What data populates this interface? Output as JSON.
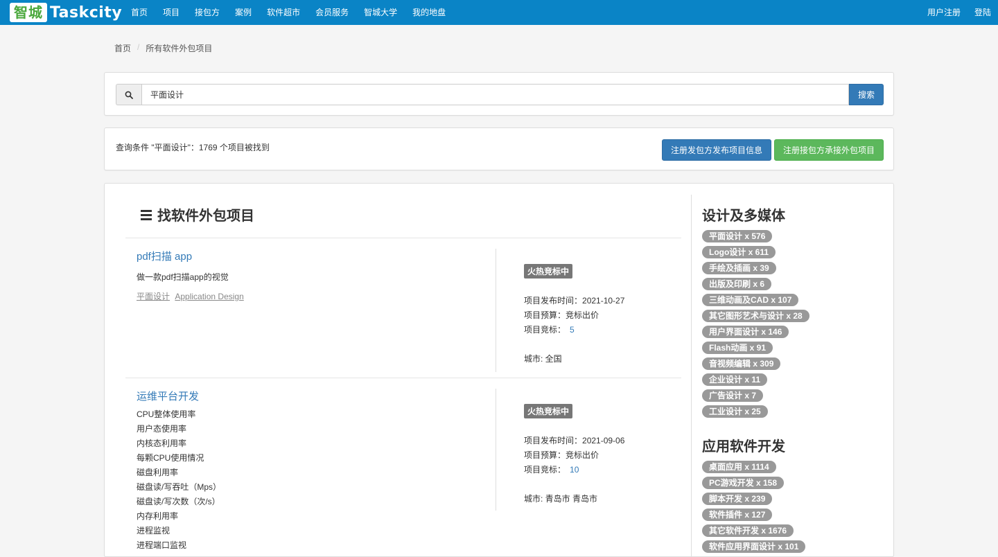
{
  "nav": {
    "logo_badge": "智城",
    "logo_text": "Taskcity",
    "menu": [
      "首页",
      "项目",
      "接包方",
      "案例",
      "软件超市",
      "会员服务",
      "智城大学",
      "我的地盘"
    ],
    "register": "用户注册",
    "login": "登陆"
  },
  "breadcrumb": {
    "home": "首页",
    "sep": "/",
    "current": "所有软件外包项目"
  },
  "search": {
    "icon": "search-icon",
    "value": "平面设计",
    "button": "搜索"
  },
  "result": {
    "text": "查询条件 \"平面设计\"：1769 个项目被找到",
    "btn_publish": "注册发包方发布项目信息",
    "btn_accept": "注册接包方承接外包项目"
  },
  "main": {
    "title": "找软件外包项目",
    "projects": [
      {
        "title": "pdf扫描 app",
        "desc": [
          "做一款pdf扫描app的视觉"
        ],
        "tags": [
          "平面设计",
          "Application Design"
        ],
        "status": "火热竞标中",
        "date_label": "项目发布时间：",
        "date": "2021-10-27",
        "budget_label": "项目预算：",
        "budget": "竞标出价",
        "bids_label": "项目竞标：",
        "bids": "5",
        "city_label": "城市: ",
        "city": "全国"
      },
      {
        "title": "运维平台开发",
        "desc": [
          "CPU整体使用率",
          "用户态使用率",
          "内核态利用率",
          "每颗CPU使用情况",
          "磁盘利用率",
          "磁盘读/写吞吐（Mps）",
          "磁盘读/写次数（次/s）",
          "内存利用率",
          "进程监视",
          "进程端口监视"
        ],
        "tags": [],
        "status": "火热竞标中",
        "date_label": "项目发布时间：",
        "date": "2021-09-06",
        "budget_label": "项目预算：",
        "budget": "竞标出价",
        "bids_label": "项目竞标：",
        "bids": "10",
        "city_label": "城市: ",
        "city": "青岛市 青岛市"
      }
    ]
  },
  "sidebar": {
    "sections": [
      {
        "title": "设计及多媒体",
        "items": [
          "平面设计 x 576",
          "Logo设计 x 611",
          "手绘及插画 x 39",
          "出版及印刷 x 6",
          "三维动画及CAD x 107",
          "其它图形艺术与设计 x 28",
          "用户界面设计 x 146",
          "Flash动画 x 91",
          "音视频编辑 x 309",
          "企业设计 x 11",
          "广告设计 x 7",
          "工业设计 x 25"
        ]
      },
      {
        "title": "应用软件开发",
        "items": [
          "桌面应用 x 1114",
          "PC游戏开发 x 158",
          "脚本开发 x 239",
          "软件插件 x 127",
          "其它软件开发 x 1676",
          "软件应用界面设计 x 101"
        ]
      }
    ]
  },
  "colors": {
    "nav": "#0a84c6",
    "primary": "#337ab7",
    "success": "#5cb85c",
    "label": "#777777",
    "badge": "#999999"
  }
}
